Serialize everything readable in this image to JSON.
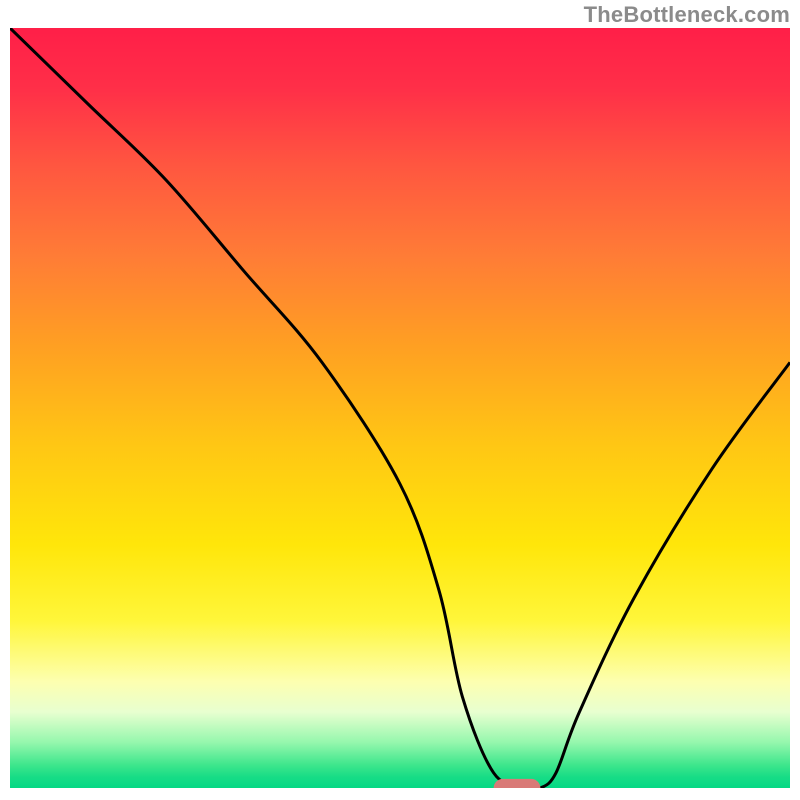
{
  "attribution": "TheBottleneck.com",
  "chart_data": {
    "type": "line",
    "title": "",
    "xlabel": "",
    "ylabel": "",
    "xlim": [
      0,
      100
    ],
    "ylim": [
      0,
      100
    ],
    "legend": false,
    "grid": false,
    "series": [
      {
        "name": "bottleneck-curve",
        "x": [
          0,
          10,
          20,
          30,
          40,
          50,
          55,
          58,
          62,
          66,
          68,
          70,
          73,
          80,
          90,
          100
        ],
        "values": [
          100,
          90,
          80,
          68,
          56,
          40,
          26,
          12,
          2,
          0,
          0,
          2,
          10,
          25,
          42,
          56
        ]
      }
    ],
    "marker": {
      "name": "optimal-point",
      "x": 65,
      "y": 0,
      "halfwidth": 3,
      "halfheight": 1.2,
      "color": "#d97a77"
    },
    "background_gradient": {
      "stops": [
        {
          "y": 0,
          "color": "#ff1f48"
        },
        {
          "y": 8,
          "color": "#ff2f48"
        },
        {
          "y": 18,
          "color": "#ff5640"
        },
        {
          "y": 30,
          "color": "#ff7c36"
        },
        {
          "y": 42,
          "color": "#ffa022"
        },
        {
          "y": 55,
          "color": "#ffc714"
        },
        {
          "y": 68,
          "color": "#ffe60a"
        },
        {
          "y": 78,
          "color": "#fff63a"
        },
        {
          "y": 86,
          "color": "#fdffb0"
        },
        {
          "y": 90,
          "color": "#e8ffd0"
        },
        {
          "y": 94,
          "color": "#95f7ad"
        },
        {
          "y": 97,
          "color": "#3de68c"
        },
        {
          "y": 98.5,
          "color": "#18dd86"
        },
        {
          "y": 100,
          "color": "#04d884"
        }
      ]
    },
    "colors": {
      "curve": "#000000",
      "marker": "#d97a77"
    }
  }
}
